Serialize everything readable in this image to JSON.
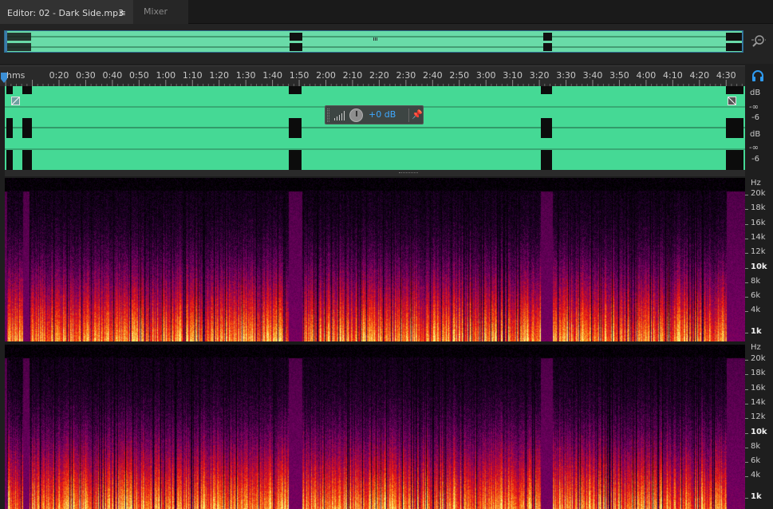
{
  "tabs": {
    "editor_label": "Editor: 02 - Dark Side.mp3",
    "editor_menu_glyph": "≡",
    "mixer_label": "Mixer"
  },
  "icons": {
    "zoom": "zoom-magnifier-icon",
    "headphones": "headphones-icon",
    "panel_menu": "menu-icon",
    "pin": "pin-icon",
    "playhead": "playhead-icon",
    "fade_in": "fade-in-handle-icon",
    "fade_out": "fade-out-handle-icon"
  },
  "ruler": {
    "unit": "hms",
    "labels": [
      "0:20",
      "0:30",
      "0:40",
      "0:50",
      "1:00",
      "1:10",
      "1:20",
      "1:30",
      "1:40",
      "1:50",
      "2:00",
      "2:10",
      "2:20",
      "2:30",
      "2:40",
      "2:50",
      "3:00",
      "3:10",
      "3:20",
      "3:30",
      "3:40",
      "3:50",
      "4:00",
      "4:10",
      "4:20",
      "4:30"
    ]
  },
  "hud": {
    "gain_value": "+0 dB"
  },
  "waveform": {
    "channels": [
      {
        "unit": "dB",
        "scale": [
          "-∞",
          "-6"
        ]
      },
      {
        "unit": "dB",
        "scale": [
          "-∞",
          "-6"
        ]
      }
    ]
  },
  "spectral": {
    "channels": [
      {
        "unit": "Hz",
        "labels": [
          "20k",
          "18k",
          "16k",
          "14k",
          "12k",
          "10k",
          "8k",
          "6k",
          "4k",
          "1k"
        ],
        "bold": [
          "10k",
          "1k"
        ]
      },
      {
        "unit": "Hz",
        "labels": [
          "20k",
          "18k",
          "16k",
          "14k",
          "12k",
          "10k",
          "8k",
          "6k",
          "4k",
          "1k"
        ],
        "bold": [
          "10k",
          "1k"
        ]
      }
    ]
  },
  "colors": {
    "waveform_bg": "#45d995",
    "overview_bg": "#69dba8",
    "accent_blue": "#3fa9ff",
    "spectral_low": "#ffe27a",
    "spectral_mid": "#e0301e",
    "spectral_high": "#5a1a6e"
  }
}
